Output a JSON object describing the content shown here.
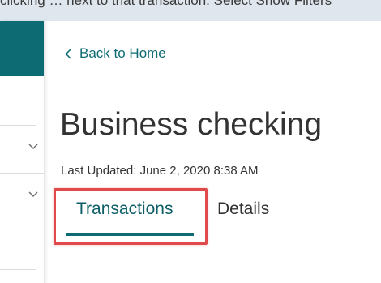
{
  "banner": {
    "text": "clicking … next to that transaction. Select Show Filters"
  },
  "sidebar": {
    "rows": [
      {
        "icon": "chevron-down-icon"
      },
      {
        "icon": "chevron-down-icon"
      }
    ]
  },
  "nav": {
    "back_label": "Back to Home"
  },
  "account": {
    "title": "Business checking",
    "last_updated": "Last Updated: June 2, 2020 8:38 AM"
  },
  "tabs": [
    {
      "label": "Transactions",
      "active": true
    },
    {
      "label": "Details",
      "active": false
    }
  ],
  "colors": {
    "accent": "#0d6b73",
    "highlight": "#e04a4a",
    "banner_bg": "#dfe6ee"
  }
}
